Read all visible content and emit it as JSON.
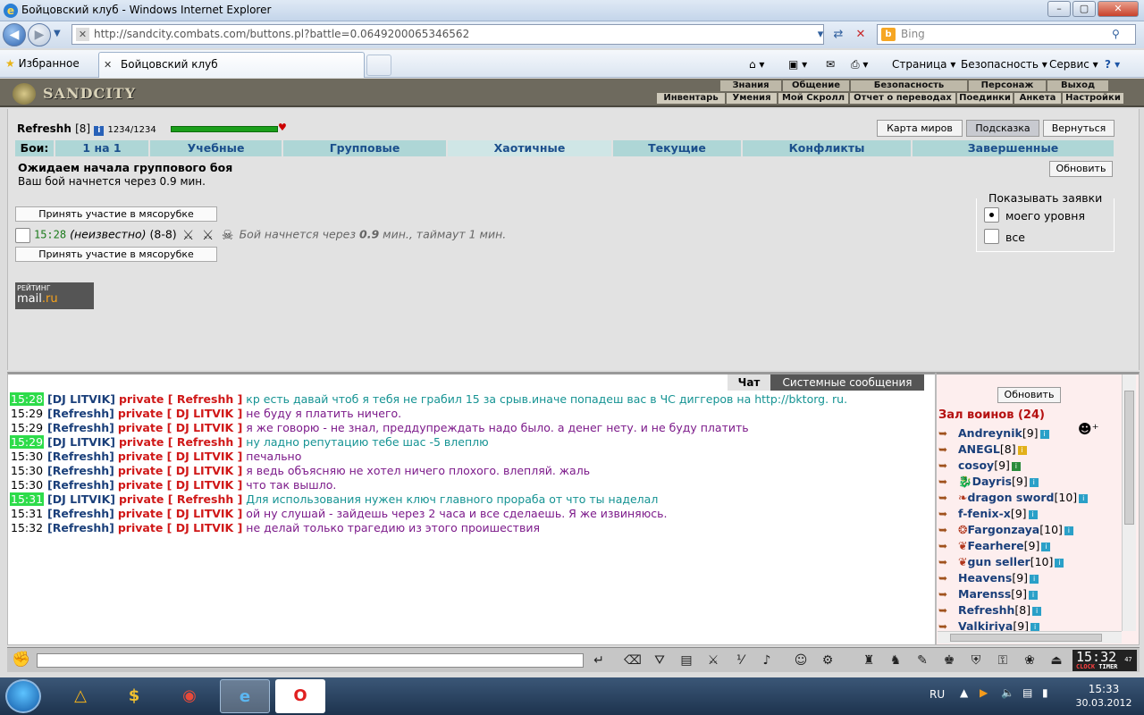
{
  "window": {
    "title": "Бойцовский клуб - Windows Internet Explorer",
    "min_label": "–",
    "max_label": "▢",
    "close_label": "✕"
  },
  "address_bar": {
    "url": "http://sandcity.combats.com/buttons.pl?battle=0.0649200065346562",
    "search_placeholder": "Bing"
  },
  "favorites_bar": {
    "favorites_label": "Избранное",
    "tab_title": "Бойцовский клуб",
    "commands": [
      "Страница ▾",
      "Безопасность ▾",
      "Сервис ▾",
      "? ▾"
    ]
  },
  "site": {
    "logo": "SANDCITY",
    "top_menu": [
      "Знания",
      "Общение",
      "Безопасность",
      "Персонаж",
      "Выход"
    ],
    "sub_menu": [
      "Инвентарь",
      "Умения",
      "Мой Скролл",
      "Отчет о переводах",
      "Поединки",
      "Анкета",
      "Настройки"
    ]
  },
  "player": {
    "name": "Refreshh",
    "level": "[8]",
    "hp": "1234/1234",
    "hp_fraction": 1.0
  },
  "page_buttons": {
    "world_map": "Карта миров",
    "hint": "Подсказка",
    "back": "Вернуться"
  },
  "fight_tabs": {
    "label": "Бои:",
    "tabs": [
      "1 на 1",
      "Учебные",
      "Групповые",
      "Хаотичные",
      "Текущие",
      "Конфликты",
      "Завершенные"
    ],
    "active_index": 3
  },
  "battle": {
    "heading": "Ожидаем начала группового боя",
    "subtext": "Ваш бой начнется через 0.9 мин.",
    "refresh_label": "Обновить",
    "join_label_top": "Принять участие в мясорубке",
    "join_label_bottom": "Принять участие в мясорубке",
    "time": "15:28",
    "unknown": "(неизвестно)",
    "range": "(8-8)",
    "desc_prefix": "Бой начнется через",
    "desc_value": "0.9",
    "desc_suffix": "мин., таймаут 1 мин."
  },
  "show_requests": {
    "legend": "Показывать заявки",
    "options": [
      "моего уровня",
      "все"
    ],
    "selected_index": 0
  },
  "rating_badge": {
    "top": "РЕЙТИНГ",
    "brand_a": "mail",
    "brand_b": ".ru"
  },
  "chat": {
    "tabs": [
      "Чат",
      "Системные сообщения"
    ],
    "lines": [
      {
        "time": "15:28",
        "hl": true,
        "from": "[DJ LITVIK]",
        "to": "private [ Refreshh ]",
        "msg": "кр есть давай чтоб я тебя не грабил 15 за срыв.иначе попадеш вас в ЧС диггеров на http://bktorg. ru.",
        "style": "a"
      },
      {
        "time": "15:29",
        "hl": false,
        "from": "[Refreshh]",
        "to": "private [ DJ LITVIK ]",
        "msg": "не буду я платить ничего.",
        "style": "b"
      },
      {
        "time": "15:29",
        "hl": false,
        "from": "[Refreshh]",
        "to": "private [ DJ LITVIK ]",
        "msg": "я же говорю - не знал, преддупреждать надо было. а денег нету. и не буду платить",
        "style": "b"
      },
      {
        "time": "15:29",
        "hl": true,
        "from": "[DJ LITVIK]",
        "to": "private [ Refreshh ]",
        "msg": "ну ладно репутацию тебе шас -5 влеплю",
        "style": "a"
      },
      {
        "time": "15:30",
        "hl": false,
        "from": "[Refreshh]",
        "to": "private [ DJ LITVIK ]",
        "msg": "печально",
        "style": "b"
      },
      {
        "time": "15:30",
        "hl": false,
        "from": "[Refreshh]",
        "to": "private [ DJ LITVIK ]",
        "msg": "я ведь объясняю не хотел ничего плохого. влепляй. жаль",
        "style": "b"
      },
      {
        "time": "15:30",
        "hl": false,
        "from": "[Refreshh]",
        "to": "private [ DJ LITVIK ]",
        "msg": "что так вышло.",
        "style": "b"
      },
      {
        "time": "15:31",
        "hl": true,
        "from": "[DJ LITVIK]",
        "to": "private [ Refreshh ]",
        "msg": "Для использования нужен ключ главного прораба от что ты наделал",
        "style": "a"
      },
      {
        "time": "15:31",
        "hl": false,
        "from": "[Refreshh]",
        "to": "private [ DJ LITVIK ]",
        "msg": "ой ну слушай - зайдешь через 2 часа и все сделаешь. Я же извиняюсь.",
        "style": "b"
      },
      {
        "time": "15:32",
        "hl": false,
        "from": "[Refreshh]",
        "to": "private [ DJ LITVIK ]",
        "msg": "не делай только трагедию из этого проишествия",
        "style": "b"
      }
    ]
  },
  "warriors": {
    "refresh_label": "Обновить",
    "heading": "Зал воинов (24)",
    "list": [
      {
        "name": "Andreynik",
        "level": "[9]",
        "badge": "blue",
        "emblem": ""
      },
      {
        "name": "ANEGL",
        "level": "[8]",
        "badge": "yellow",
        "emblem": ""
      },
      {
        "name": "cosoy",
        "level": "[9]",
        "badge": "green",
        "emblem": ""
      },
      {
        "name": "Dayris",
        "level": "[9]",
        "badge": "blue",
        "emblem": "dragon"
      },
      {
        "name": "dragon sword",
        "level": "[10]",
        "badge": "blue",
        "emblem": "wings"
      },
      {
        "name": "f-fenix-x",
        "level": "[9]",
        "badge": "blue",
        "emblem": ""
      },
      {
        "name": "Fargonzaya",
        "level": "[10]",
        "badge": "blue",
        "emblem": "flame"
      },
      {
        "name": "Fearhere",
        "level": "[9]",
        "badge": "blue",
        "emblem": "bird"
      },
      {
        "name": "gun seller",
        "level": "[10]",
        "badge": "blue",
        "emblem": "bird"
      },
      {
        "name": "Heavens",
        "level": "[9]",
        "badge": "blue",
        "emblem": ""
      },
      {
        "name": "Marenss",
        "level": "[9]",
        "badge": "blue",
        "emblem": ""
      },
      {
        "name": "Refreshh",
        "level": "[8]",
        "badge": "blue",
        "emblem": ""
      },
      {
        "name": "Valkiriya",
        "level": "[9]",
        "badge": "blue",
        "emblem": ""
      }
    ]
  },
  "clock_widget": {
    "time": "15:32",
    "seconds": "47",
    "label_a": "CLOCK",
    "label_b": "TIMER"
  },
  "taskbar": {
    "lang": "RU",
    "time": "15:33",
    "date": "30.03.2012"
  },
  "colors": {
    "hl_time": "#2ddc4a",
    "private": "#d01818",
    "name": "#1a3f7a",
    "msg_in": "#159393",
    "msg_out": "#7c1a8a"
  }
}
